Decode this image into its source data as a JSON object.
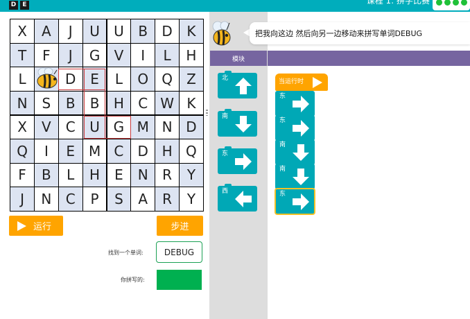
{
  "header": {
    "logo_letters": [
      "D",
      "E"
    ],
    "course_title": "课程 1: 拼字比赛",
    "progress_dots": 4
  },
  "grid": {
    "rows": [
      [
        "X",
        "A",
        "J",
        "U",
        "U",
        "B",
        "D",
        "K"
      ],
      [
        "T",
        "F",
        "J",
        "G",
        "V",
        "I",
        "L",
        "H"
      ],
      [
        "L",
        "",
        "D",
        "E",
        "L",
        "O",
        "Q",
        "Z"
      ],
      [
        "N",
        "S",
        "B",
        "B",
        "H",
        "C",
        "W",
        "K"
      ],
      [
        "X",
        "V",
        "C",
        "U",
        "G",
        "M",
        "N",
        "D"
      ],
      [
        "Q",
        "I",
        "E",
        "M",
        "C",
        "D",
        "H",
        "Q"
      ],
      [
        "F",
        "B",
        "L",
        "H",
        "E",
        "N",
        "R",
        "Y"
      ],
      [
        "J",
        "N",
        "C",
        "P",
        "S",
        "A",
        "R",
        "Y"
      ]
    ],
    "bee_icon": "bee-icon",
    "highlight_color": "#c8383a"
  },
  "controls": {
    "run_label": "运行",
    "step_label": "步进",
    "found_word_label": "找到一个单词:",
    "found_word_value": "DEBUG",
    "spelled_label": "你拼写的:",
    "spelled_value": "",
    "button_color": "#ffa400",
    "spelled_color": "#00b050"
  },
  "instruction": {
    "mascot_icon": "bee-mascot-icon",
    "text": "把我向这边 然后向另一边移动来拼写单词DEBUG"
  },
  "toolbox": {
    "title": "模块",
    "blocks": [
      {
        "label": "北",
        "icon": "arrow-up-icon"
      },
      {
        "label": "南",
        "icon": "arrow-down-icon"
      },
      {
        "label": "东",
        "icon": "arrow-right-icon"
      },
      {
        "label": "西",
        "icon": "arrow-left-icon"
      }
    ]
  },
  "workspace": {
    "hat_label": "当运行时",
    "hat_icon": "play-icon",
    "program": [
      {
        "label": "东",
        "icon": "arrow-right-icon"
      },
      {
        "label": "东",
        "icon": "arrow-right-icon"
      },
      {
        "label": "南",
        "icon": "arrow-down-icon"
      },
      {
        "label": "南",
        "icon": "arrow-down-icon"
      },
      {
        "label": "东",
        "icon": "arrow-right-icon",
        "selected": true
      }
    ],
    "block_color": "#00a8b6",
    "header_color": "#7665a0"
  }
}
